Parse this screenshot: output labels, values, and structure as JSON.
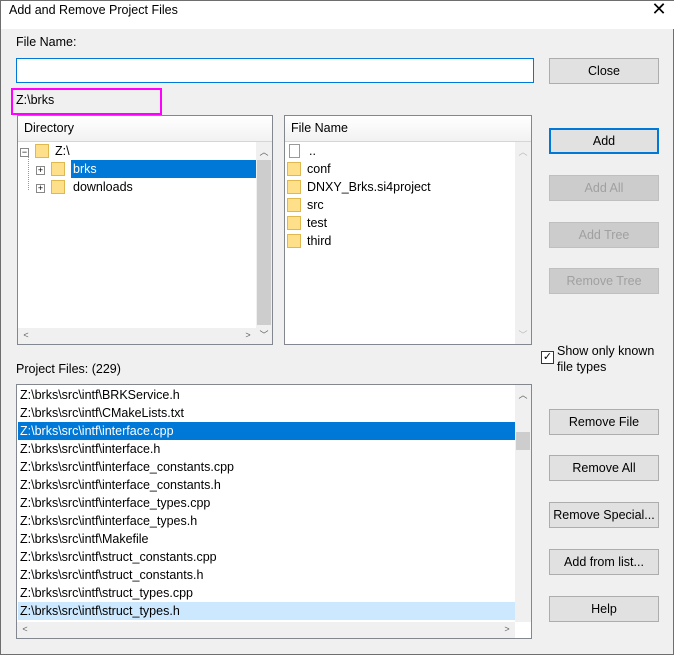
{
  "window": {
    "title": "Add and Remove Project Files",
    "close_glyph": "✕"
  },
  "file_name": {
    "label": "File Name:",
    "value": ""
  },
  "current_path": "Z:\\brks",
  "directory": {
    "header": "Directory",
    "items": [
      {
        "label": "Z:\\",
        "expander": "−"
      },
      {
        "label": "brks",
        "expander": "+",
        "selected": true
      },
      {
        "label": "downloads",
        "expander": "+"
      }
    ]
  },
  "files": {
    "header": "File Name",
    "items": [
      "..",
      "conf",
      "DNXY_Brks.si4project",
      "src",
      "test",
      "third"
    ]
  },
  "buttons": {
    "close": "Close",
    "add": "Add",
    "add_all": "Add All",
    "add_tree": "Add Tree",
    "remove_tree": "Remove Tree",
    "remove_file": "Remove File",
    "remove_all": "Remove All",
    "remove_special": "Remove Special...",
    "add_from_list": "Add from list...",
    "help": "Help"
  },
  "show_known": {
    "line1": "Show only known",
    "line2": "file types",
    "checked": true
  },
  "project_files": {
    "label": "Project Files: (229)",
    "items": [
      "Z:\\brks\\src\\intf\\BRKService.h",
      "Z:\\brks\\src\\intf\\CMakeLists.txt",
      "Z:\\brks\\src\\intf\\interface.cpp",
      "Z:\\brks\\src\\intf\\interface.h",
      "Z:\\brks\\src\\intf\\interface_constants.cpp",
      "Z:\\brks\\src\\intf\\interface_constants.h",
      "Z:\\brks\\src\\intf\\interface_types.cpp",
      "Z:\\brks\\src\\intf\\interface_types.h",
      "Z:\\brks\\src\\intf\\Makefile",
      "Z:\\brks\\src\\intf\\struct_constants.cpp",
      "Z:\\brks\\src\\intf\\struct_constants.h",
      "Z:\\brks\\src\\intf\\struct_types.cpp",
      "Z:\\brks\\src\\intf\\struct_types.h"
    ]
  }
}
